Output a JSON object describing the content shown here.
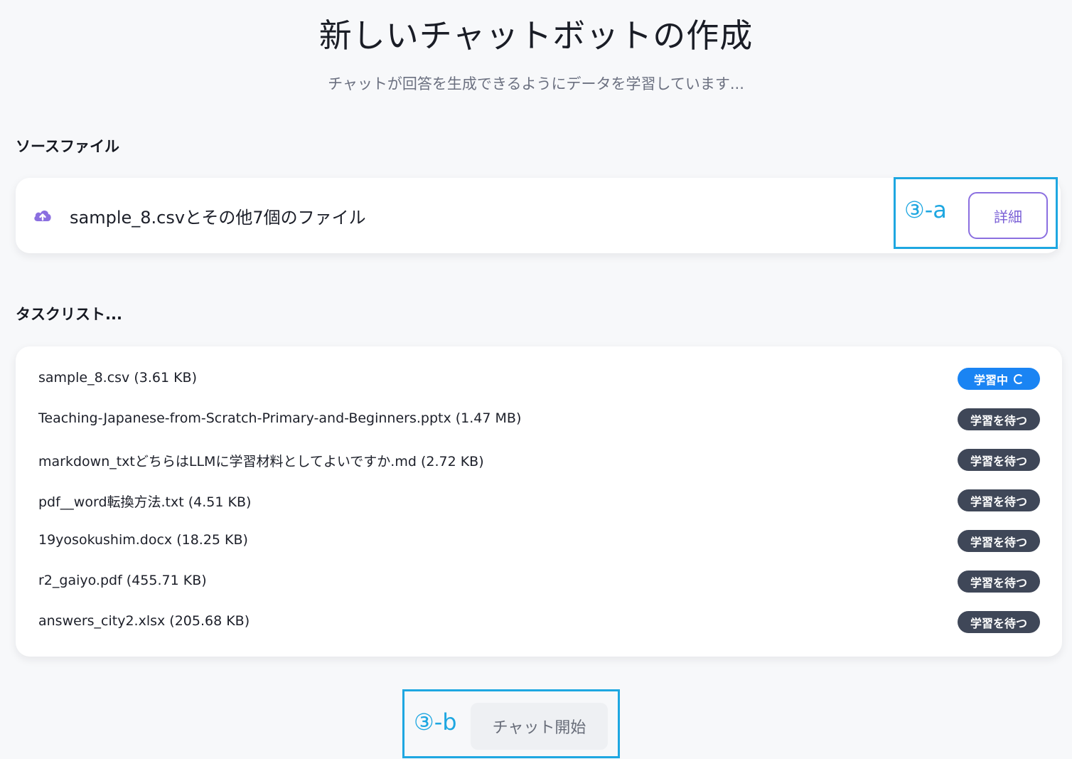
{
  "header": {
    "title": "新しいチャットボットの作成",
    "subtitle": "チャットが回答を生成できるようにデータを学習しています..."
  },
  "source": {
    "section_label": "ソースファイル",
    "summary": "sample_8.csvとその他7個のファイル",
    "detail_button": "詳細",
    "icon": "cloud-upload-icon"
  },
  "tasks": {
    "section_label": "タスクリスト...",
    "items": [
      {
        "name": "sample_8.csv (3.61 KB)",
        "status": "学習中",
        "state": "active"
      },
      {
        "name": "Teaching-Japanese-from-Scratch-Primary-and-Beginners.pptx (1.47 MB)",
        "status": "学習を待つ",
        "state": "waiting"
      },
      {
        "name": "markdown_txtどちらはLLMに学習材料としてよいですか.md (2.72 KB)",
        "status": "学習を待つ",
        "state": "waiting"
      },
      {
        "name": "pdf__word転換方法.txt (4.51 KB)",
        "status": "学習を待つ",
        "state": "waiting"
      },
      {
        "name": "19yosokushim.docx (18.25 KB)",
        "status": "学習を待つ",
        "state": "waiting"
      },
      {
        "name": "r2_gaiyo.pdf (455.71 KB)",
        "status": "学習を待つ",
        "state": "waiting"
      },
      {
        "name": "answers_city2.xlsx (205.68 KB)",
        "status": "学習を待つ",
        "state": "waiting"
      }
    ]
  },
  "footer": {
    "start_button": "チャット開始"
  },
  "annotations": {
    "a": "③-a",
    "b": "③-b"
  },
  "colors": {
    "accent": "#1a84f3",
    "badge_wait": "#3f4758",
    "annotation": "#1ea7e1",
    "detail_border": "#8b6fe0"
  }
}
